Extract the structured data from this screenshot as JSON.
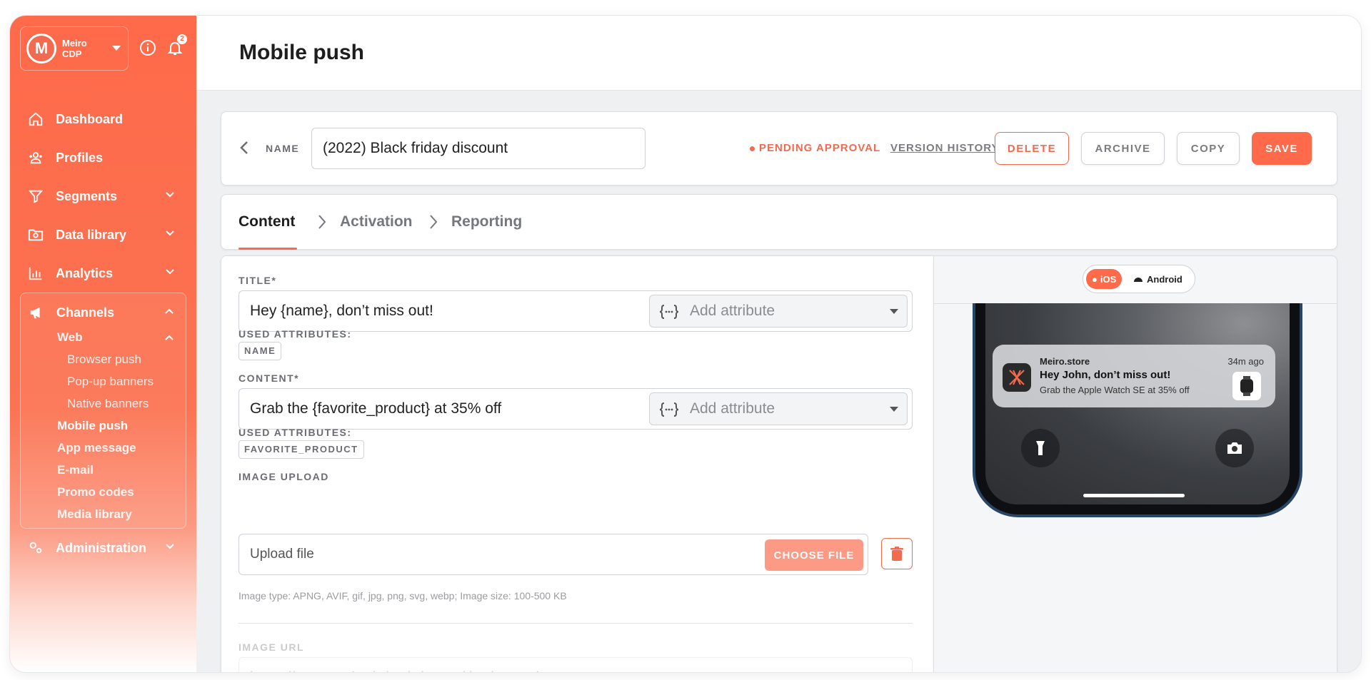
{
  "brand": {
    "name_line1": "Meiro",
    "name_line2": "CDP",
    "logo_letter": "M",
    "notification_count": "2"
  },
  "sidebar": {
    "items": [
      {
        "label": "Dashboard"
      },
      {
        "label": "Profiles"
      },
      {
        "label": "Segments"
      },
      {
        "label": "Data library"
      },
      {
        "label": "Analytics"
      },
      {
        "label": "Channels"
      },
      {
        "label": "Administration"
      }
    ],
    "channels_sub": {
      "web": "Web",
      "web_children": [
        "Browser push",
        "Pop-up banners",
        "Native banners"
      ],
      "others": [
        "Mobile push",
        "App message",
        "E-mail",
        "Promo codes",
        "Media library"
      ]
    }
  },
  "header": {
    "title": "Mobile push"
  },
  "namebar": {
    "name_label": "NAME",
    "name_value": "(2022) Black friday discount",
    "status": "PENDING APPROVAL",
    "version_history": "VERSION HISTORY",
    "delete": "DELETE",
    "archive": "ARCHIVE",
    "copy": "COPY",
    "save": "SAVE"
  },
  "tabs": [
    {
      "label": "Content"
    },
    {
      "label": "Activation"
    },
    {
      "label": "Reporting"
    }
  ],
  "form": {
    "title_label": "TITLE*",
    "title_value": "Hey {name}, don’t miss out!",
    "add_attribute": "Add attribute",
    "used_attributes_label": "USED ATTRIBUTES:",
    "title_attr_tag": "NAME",
    "content_label": "CONTENT*",
    "content_value": "Grab the {favorite_product} at 35% off",
    "content_attr_tag": "FAVORITE_PRODUCT",
    "image_upload_label": "IMAGE UPLOAD",
    "upload_placeholder": "Upload file",
    "choose_file": "CHOOSE FILE",
    "image_hint": "Image type: APNG, AVIF, gif, jpg, png, svg, webp; Image size: 100-500 KB",
    "image_url_label": "IMAGE URL",
    "image_url_placeholder": "https://www.meiro.io/web-layers/the-image.jpg"
  },
  "preview": {
    "ios": "iOS",
    "android": "Android",
    "notification": {
      "app": "Meiro.store",
      "time": "34m ago",
      "title": "Hey John, don’t miss out!",
      "body": "Grab the Apple Watch SE at 35% off"
    }
  },
  "colors": {
    "accent": "#fe6a4a",
    "accent_light": "#fd9a85"
  }
}
